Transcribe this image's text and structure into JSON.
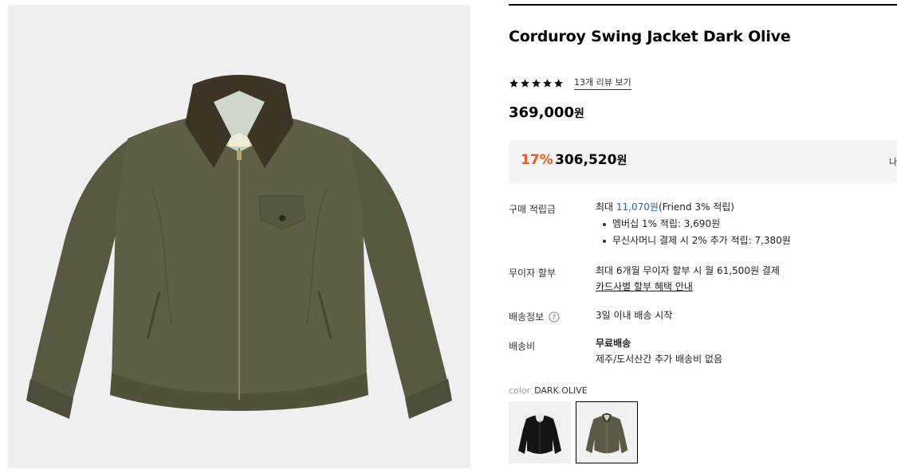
{
  "product": {
    "title": "Corduroy Swing Jacket Dark Olive",
    "image_icon": "jacket-image",
    "rating": {
      "stars": 5,
      "review_link": "13개 리뷰 보기"
    },
    "price": {
      "amount": "369,000",
      "currency": "원"
    },
    "discount": {
      "percent": "17%",
      "amount": "306,520",
      "currency": "원",
      "side_text": "나"
    }
  },
  "details": {
    "points": {
      "label": "구매 적립금",
      "max_prefix": "최대 ",
      "max_amount": "11,070원",
      "max_suffix": "(Friend 3% 적립)",
      "items": [
        "멤버십 1% 적립: 3,690원",
        "무신사머니 결제 시 2% 추가 적립: 7,380원"
      ]
    },
    "installment": {
      "label": "무이자 할부",
      "text": "최대 6개월 무이자 할부 시 월 61,500원 결제",
      "link": "카드사별 할부 혜택 안내"
    },
    "shipping_info": {
      "label": "배송정보",
      "text": "3일 이내 배송 시작"
    },
    "shipping_fee": {
      "label": "배송비",
      "text": "무료배송",
      "subtext": "제주/도서산간 추가 배송비 없음"
    }
  },
  "color": {
    "label": "color",
    "value": "DARK OLIVE",
    "options": [
      {
        "name": "BLACK",
        "selected": false
      },
      {
        "name": "DARK OLIVE",
        "selected": true
      }
    ]
  },
  "colors": {
    "accent": "#f05a1a",
    "link": "#1a5fd3",
    "olive": "#5b5a44",
    "black": "#1a1a1a"
  }
}
